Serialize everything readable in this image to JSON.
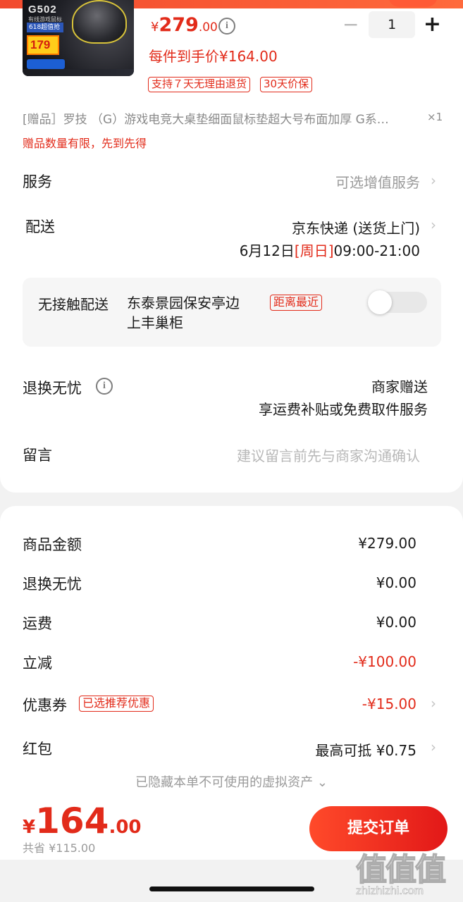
{
  "product": {
    "thumb": {
      "brand_text": "G502",
      "sub_text": "有线游戏鼠标",
      "tag_text": "618超值抢",
      "price_text": "179"
    },
    "price": {
      "symbol": "¥",
      "integer": "279",
      "decimal": ".00"
    },
    "per_item_price": "每件到手价¥164.00",
    "quantity": "1",
    "minus_symbol": "−",
    "plus_symbol": "+",
    "badges": [
      "支持７天无理由退货",
      "30天价保"
    ]
  },
  "gift": {
    "text": "[赠品］罗技 （G）游戏电竞大桌垫细面鼠标垫超大号布面加厚 G系…",
    "count": "×1",
    "note": "赠品数量有限，先到先得"
  },
  "service": {
    "label": "服务",
    "value": "可选增值服务"
  },
  "delivery": {
    "label": "配送",
    "method": "京东快递 (送货上门)",
    "date": "6月12日",
    "weekday": "[周日]",
    "time": "09:00-21:00"
  },
  "contactless": {
    "label": "无接触配送",
    "location_line1": "东泰景园保安亭边",
    "location_line2": "上丰巢柜",
    "badge": "距离最近",
    "enabled": false
  },
  "return_worry_free": {
    "label": "退换无忧",
    "value_line1": "商家赠送",
    "value_line2": "享运费补贴或免费取件服务"
  },
  "message": {
    "label": "留言",
    "placeholder": "建议留言前先与商家沟通确认"
  },
  "summary": {
    "goods_amount": {
      "label": "商品金额",
      "value": "¥279.00"
    },
    "return_fee": {
      "label": "退换无忧",
      "value": "¥0.00"
    },
    "shipping": {
      "label": "运费",
      "value": "¥0.00"
    },
    "instant_discount": {
      "label": "立减",
      "value": "-¥100.00"
    },
    "coupon": {
      "label": "优惠券",
      "badge": "已选推荐优惠",
      "value": "-¥15.00"
    },
    "red_packet": {
      "label": "红包",
      "value": "最高可抵 ¥0.75"
    },
    "hidden_assets": "已隐藏本单不可使用的虚拟资产"
  },
  "footer": {
    "total_symbol": "¥",
    "total_integer": "164",
    "total_decimal": ".00",
    "saved": "共省 ¥115.00",
    "submit_label": "提交订单"
  },
  "watermark": {
    "big": "值值值",
    "small": "zhizhizhi.com"
  },
  "colors": {
    "accent": "#e22b1a",
    "gray": "#9a9a9a"
  }
}
